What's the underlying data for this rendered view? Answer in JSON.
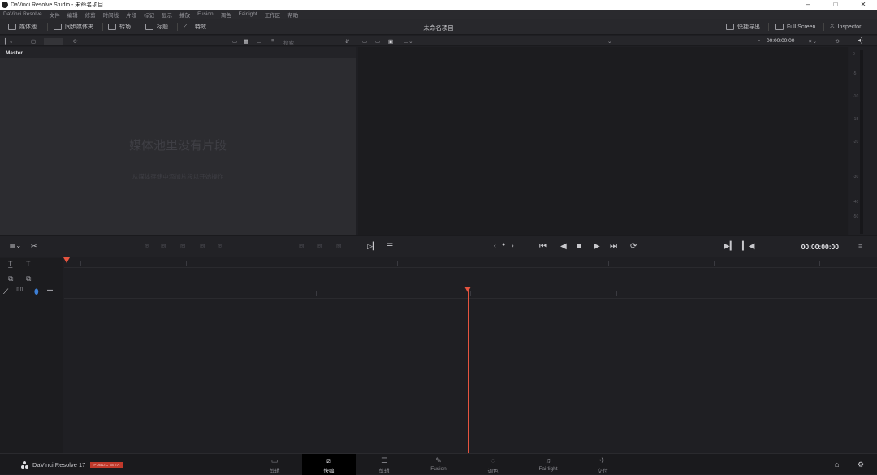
{
  "window": {
    "title": "DaVinci Resolve Studio - 未命名项目",
    "controls": [
      "–",
      "□",
      "✕"
    ]
  },
  "menu": [
    "DaVinci Resolve",
    "文件",
    "编辑",
    "修剪",
    "时间线",
    "片段",
    "标记",
    "显示",
    "播放",
    "Fusion",
    "调色",
    "Fairlight",
    "工作区",
    "帮助"
  ],
  "toolbar": {
    "media_pool": "媒体池",
    "sync_bin": "同步媒体夹",
    "transitions": "转场",
    "titles": "标题",
    "effects": "特效",
    "project_title": "未命名项目",
    "quick_export": "快捷导出",
    "full_screen": "Full Screen",
    "inspector": "Inspector"
  },
  "subbar": {
    "search_placeholder": "搜索",
    "timecode": "00:00:00:00"
  },
  "media_pool": {
    "tab": "Master",
    "hint": "媒体池里没有片段",
    "sub_hint": "从媒体存储中添加片段以开始操作"
  },
  "meter": {
    "labels": [
      "0",
      "-5",
      "-10",
      "-15",
      "-20",
      "-30",
      "-40",
      "-50"
    ]
  },
  "transport": {
    "timecode": "00:00:00:00"
  },
  "page_bar": {
    "app_name": "DaVinci Resolve 17",
    "badge": "PUBLIC BETA",
    "tabs": [
      {
        "label": "剪辑",
        "icon": "▭"
      },
      {
        "label": "快编",
        "icon": "⧄"
      },
      {
        "label": "剪辑",
        "icon": "☰"
      },
      {
        "label": "Fusion",
        "icon": "✎"
      },
      {
        "label": "调色",
        "icon": "◌"
      },
      {
        "label": "Fairlight",
        "icon": "♫"
      },
      {
        "label": "交付",
        "icon": "✈"
      }
    ],
    "active_tab_index": 1
  },
  "colors": {
    "playhead": "#e6543f",
    "badge": "#c0392b",
    "background": "#1f1f23"
  }
}
